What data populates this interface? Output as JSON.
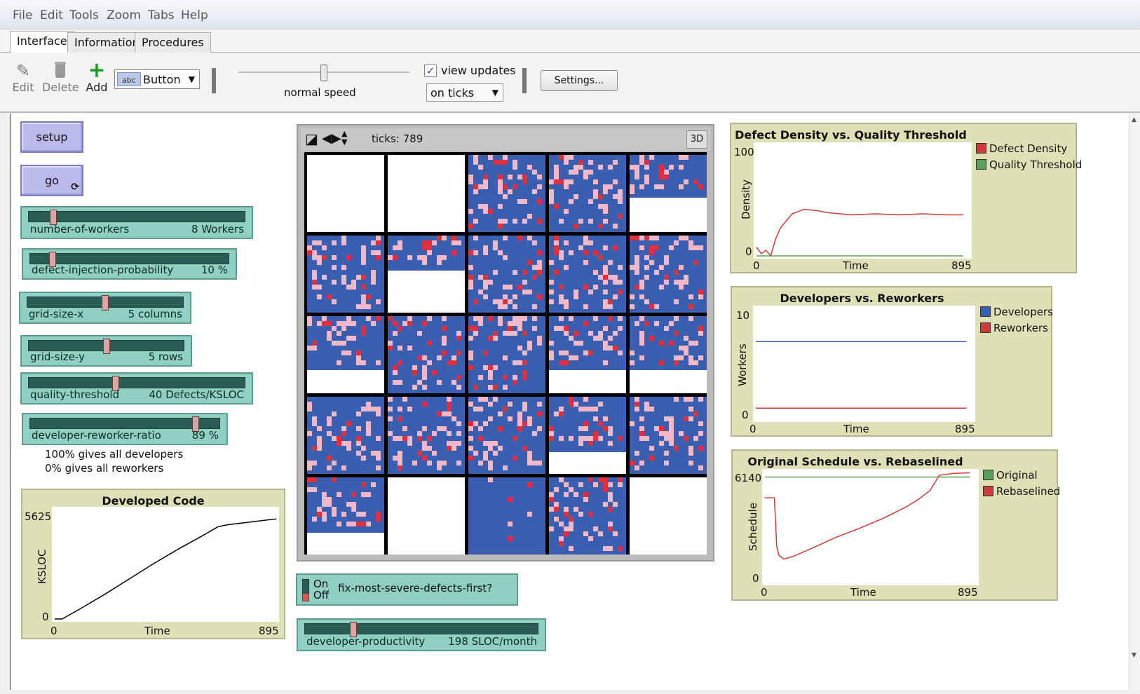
{
  "menu": [
    "File",
    "Edit",
    "Tools",
    "Zoom",
    "Tabs",
    "Help"
  ],
  "tabs": [
    "Interface",
    "Information",
    "Procedures"
  ],
  "toolbar": {
    "edit": "Edit",
    "delete": "Delete",
    "add": "Add",
    "widget_type": "Button",
    "widget_abc": "abc",
    "speed_label": "normal speed",
    "speed": 0.5,
    "view_updates": "view updates",
    "view_updates_checked": true,
    "update_mode": "on ticks",
    "settings": "Settings..."
  },
  "buttons": {
    "setup": "setup",
    "go": "go"
  },
  "sliders": [
    {
      "name": "number-of-workers",
      "value": "8 Workers",
      "fraction": 0.1
    },
    {
      "name": "defect-injection-probability",
      "value": "10 %",
      "fraction": 0.1
    },
    {
      "name": "grid-size-x",
      "value": "5 columns",
      "fraction": 0.5
    },
    {
      "name": "grid-size-y",
      "value": "5 rows",
      "fraction": 0.5
    },
    {
      "name": "quality-threshold",
      "value": "40 Defects/KSLOC",
      "fraction": 0.4
    },
    {
      "name": "developer-reworker-ratio",
      "value": "89 %",
      "fraction": 0.89
    }
  ],
  "ratio_notes": [
    "100% gives all developers",
    "0% gives all reworkers"
  ],
  "switch": {
    "on": "On",
    "off": "Off",
    "label": "fix-most-severe-defects-first?",
    "state": "off"
  },
  "productivity": {
    "name": "developer-productivity",
    "value": "198 SLOC/month",
    "fraction": 0.2
  },
  "view": {
    "ticks": "ticks: 789",
    "three_d": "3D"
  },
  "colors": {
    "developer": "#3a5fb0",
    "defect_light": "#f0b8c8",
    "defect_dark": "#e03040",
    "plot_bg": "#e0e0b6"
  },
  "grid_fill": [
    [
      0,
      0,
      1,
      1,
      0.55
    ],
    [
      1,
      0.45,
      1,
      1,
      1
    ],
    [
      0.7,
      1,
      1,
      0.7,
      0.7
    ],
    [
      1,
      1,
      1,
      0.72,
      1
    ],
    [
      0.72,
      0,
      1,
      1,
      0
    ]
  ],
  "chart_data": [
    {
      "type": "line",
      "title": "Developed Code",
      "xlabel": "Time",
      "ylabel": "KSLOC",
      "xlim": [
        0,
        895
      ],
      "ylim": [
        0,
        5625
      ],
      "x_ticks": [
        "0",
        "895"
      ],
      "y_ticks": [
        "0",
        "5625"
      ],
      "series": [
        {
          "color": "#000000",
          "x": [
            0,
            30,
            100,
            200,
            300,
            400,
            500,
            600,
            660,
            700,
            800,
            895
          ],
          "y": [
            0,
            0,
            500,
            1250,
            2050,
            2850,
            3600,
            4300,
            4750,
            4850,
            5000,
            5150
          ]
        }
      ]
    },
    {
      "type": "line",
      "title": "Defect Density vs. Quality Threshold",
      "xlabel": "Time",
      "ylabel": "Density",
      "xlim": [
        0,
        895
      ],
      "ylim": [
        0,
        100
      ],
      "x_ticks": [
        "0",
        "895"
      ],
      "y_ticks": [
        "0",
        "100"
      ],
      "legend_position": "right",
      "series": [
        {
          "name": "Defect Density",
          "color": "#d03a3a",
          "x": [
            0,
            20,
            40,
            60,
            80,
            100,
            150,
            200,
            250,
            300,
            400,
            500,
            600,
            700,
            800,
            870
          ],
          "y": [
            8,
            2,
            5,
            0,
            15,
            25,
            38,
            42,
            41,
            39,
            37,
            38,
            37,
            38,
            37,
            37
          ]
        },
        {
          "name": "Quality Threshold",
          "color": "#5aa05a",
          "x": [
            0,
            870
          ],
          "y": [
            0,
            0
          ]
        }
      ]
    },
    {
      "type": "line",
      "title": "Developers vs. Reworkers",
      "xlabel": "Time",
      "ylabel": "Workers",
      "xlim": [
        0,
        895
      ],
      "ylim": [
        0,
        10
      ],
      "x_ticks": [
        "0",
        "895"
      ],
      "y_ticks": [
        "0",
        "10"
      ],
      "legend_position": "right",
      "series": [
        {
          "name": "Developers",
          "color": "#3a5fb0",
          "x": [
            0,
            870
          ],
          "y": [
            7,
            7
          ]
        },
        {
          "name": "Reworkers",
          "color": "#d03a3a",
          "x": [
            0,
            870
          ],
          "y": [
            1,
            1
          ]
        }
      ]
    },
    {
      "type": "line",
      "title": "Original Schedule vs. Rebaselined Sc...",
      "xlabel": "Time",
      "ylabel": "Schedule",
      "xlim": [
        0,
        895
      ],
      "ylim": [
        0,
        6140
      ],
      "x_ticks": [
        "0",
        "895"
      ],
      "y_ticks": [
        "0",
        "6140"
      ],
      "legend_position": "right",
      "series": [
        {
          "name": "Original",
          "color": "#5aa05a",
          "x": [
            0,
            870
          ],
          "y": [
            5850,
            5850
          ]
        },
        {
          "name": "Rebaselined",
          "color": "#d03a3a",
          "x": [
            0,
            40,
            50,
            60,
            80,
            120,
            200,
            300,
            400,
            500,
            600,
            650,
            700,
            740,
            800,
            870
          ],
          "y": [
            4700,
            4700,
            2000,
            1500,
            1300,
            1450,
            1900,
            2500,
            3000,
            3550,
            4200,
            4600,
            5100,
            5950,
            6050,
            6080
          ]
        }
      ]
    }
  ]
}
